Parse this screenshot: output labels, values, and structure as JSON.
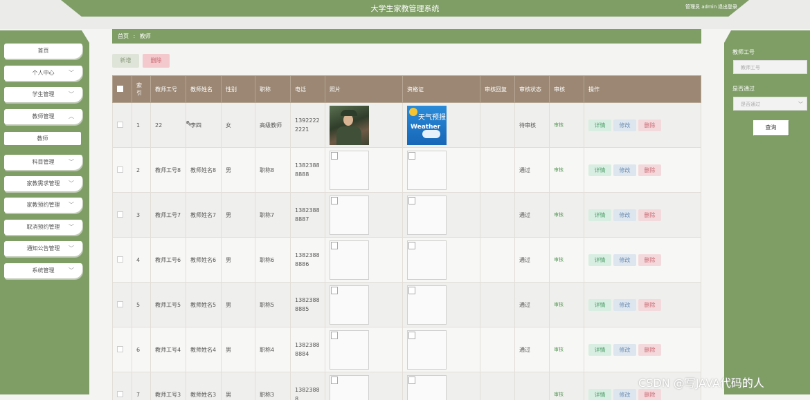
{
  "header": {
    "title": "大学生家教管理系统",
    "user": "管理员 admin",
    "logout": "退出登录"
  },
  "sidebar": {
    "items": [
      {
        "label": "首页"
      },
      {
        "label": "个人中心"
      },
      {
        "label": "学生管理"
      },
      {
        "label": "教师管理"
      },
      {
        "label": "科目管理"
      },
      {
        "label": "家教需求管理"
      },
      {
        "label": "家教预约管理"
      },
      {
        "label": "取消预约管理"
      },
      {
        "label": "通知公告管理"
      },
      {
        "label": "系统管理"
      }
    ],
    "sub_item": "教师"
  },
  "breadcrumb": {
    "home": "首页",
    "separator": ":",
    "current": "教师"
  },
  "toolbar": {
    "add": "新增",
    "delete": "删除"
  },
  "table": {
    "headers": [
      "索引",
      "教师工号",
      "教师姓名",
      "性别",
      "职称",
      "电话",
      "照片",
      "资格证",
      "审核回复",
      "审核状态",
      "审核",
      "操作"
    ],
    "audit_link": "审核",
    "btn_detail": "详情",
    "btn_edit": "修改",
    "btn_delete": "删除",
    "rows": [
      {
        "index": "1",
        "id": "22",
        "name": "李四",
        "gender": "女",
        "title": "高级教师",
        "phone": "13922222221",
        "reply": "",
        "status": "待审核"
      },
      {
        "index": "2",
        "id": "教师工号8",
        "name": "教师姓名8",
        "gender": "男",
        "title": "职称8",
        "phone": "13823888888",
        "reply": "",
        "status": "通过"
      },
      {
        "index": "3",
        "id": "教师工号7",
        "name": "教师姓名7",
        "gender": "男",
        "title": "职称7",
        "phone": "13823888887",
        "reply": "",
        "status": "通过"
      },
      {
        "index": "4",
        "id": "教师工号6",
        "name": "教师姓名6",
        "gender": "男",
        "title": "职称6",
        "phone": "13823888886",
        "reply": "",
        "status": "通过"
      },
      {
        "index": "5",
        "id": "教师工号5",
        "name": "教师姓名5",
        "gender": "男",
        "title": "职称5",
        "phone": "13823888885",
        "reply": "",
        "status": "通过"
      },
      {
        "index": "6",
        "id": "教师工号4",
        "name": "教师姓名4",
        "gender": "男",
        "title": "职称4",
        "phone": "13823888884",
        "reply": "",
        "status": "通过"
      },
      {
        "index": "7",
        "id": "教师工号3",
        "name": "教师姓名3",
        "gender": "男",
        "title": "职称3",
        "phone": "13823888",
        "reply": "",
        "status": ""
      }
    ]
  },
  "weather_cert": {
    "cn": "天气预报",
    "en": "Weather"
  },
  "search": {
    "id_label": "教师工号",
    "id_placeholder": "教师工号",
    "pass_label": "是否通过",
    "pass_placeholder": "是否通过",
    "query": "查询"
  },
  "watermark": "CSDN @写JAVA代码的人",
  "colors": {
    "primary": "#7f9e66",
    "table_header": "#9b8773"
  }
}
